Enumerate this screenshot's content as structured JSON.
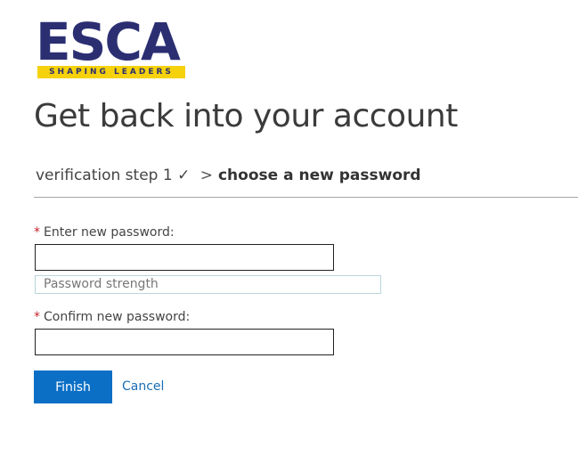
{
  "logo": {
    "word": "ESCA",
    "tagline": "SHAPING LEADERS",
    "colors": {
      "word": "#2b2f72",
      "band": "#f5d20b"
    }
  },
  "title": "Get back into your account",
  "breadcrumb": {
    "step1": "verification step 1",
    "check": "✓",
    "separator": ">",
    "current": "choose a new password"
  },
  "form": {
    "required_marker": "*",
    "new_password_label": "Enter new password:",
    "new_password_value": "",
    "strength_text": "Password strength",
    "confirm_password_label": "Confirm new password:",
    "confirm_password_value": ""
  },
  "actions": {
    "finish_label": "Finish",
    "cancel_label": "Cancel"
  },
  "colors": {
    "primary_button": "#0b6fc6",
    "link": "#1a6eb5",
    "required": "#c4262e"
  }
}
